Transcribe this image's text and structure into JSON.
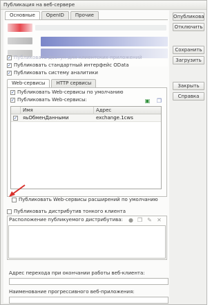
{
  "window": {
    "title": "Публикация на веб-сервере"
  },
  "tabs": [
    "Основные",
    "OpenID",
    "Прочие"
  ],
  "sidebar": {
    "publish": "Опубликовать",
    "unpublish": "Отключить",
    "save": "Сохранить",
    "load": "Загрузить",
    "close": "Закрыть",
    "help": "Справка"
  },
  "options": {
    "hidden_row": "Публиковать доступ для клиентских приложений",
    "odata": "Публиковать стандартный интерфейс OData",
    "analytics": "Публиковать систему аналитики"
  },
  "inner_tabs": [
    "Web-сервисы",
    "HTTP сервисы"
  ],
  "web": {
    "default_label": "Публиковать Web-сервисы по умолчанию",
    "publish_label": "Публиковать Web-сервисы:",
    "columns": [
      "Имя",
      "Адрес"
    ],
    "rows": [
      {
        "name": "яьОбменДанными",
        "address": "exchange.1cws",
        "checked": true
      }
    ],
    "ext_label": "Публиковать Web-сервисы расширений по умолчанию"
  },
  "thin_client": {
    "label": "Публиковать дистрибутив тонкого клиента",
    "location_label": "Расположение публикуемого дистрибутива:"
  },
  "fields": {
    "redirect_label": "Адрес перехода при окончании работы веб-клиента:",
    "pwa_label": "Наименование прогрессивного веб-приложения:"
  }
}
